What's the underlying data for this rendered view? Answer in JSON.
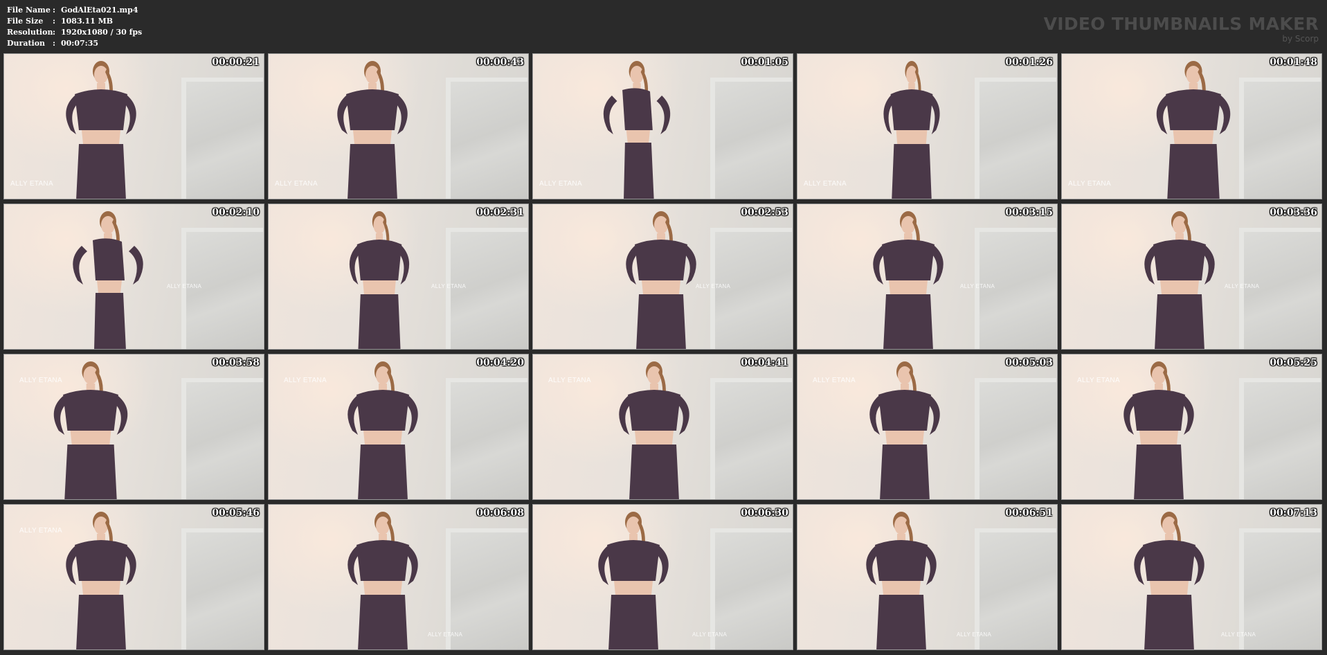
{
  "header": {
    "file_name_label": "File Name",
    "file_name_value": "GodAlEta021.mp4",
    "file_size_label": "File Size",
    "file_size_value": "1083.11 MB",
    "resolution_label": "Resolution",
    "resolution_value": "1920x1080 / 30 fps",
    "duration_label": "Duration",
    "duration_value": "00:07:35",
    "separator": ":",
    "brand_title": "VIDEO THUMBNAILS MAKER",
    "brand_sub": "by Scorp"
  },
  "thumbnails": [
    {
      "time": "00:00:21",
      "watermark": "ALLY ETANA",
      "wm_pos": "bl"
    },
    {
      "time": "00:00:43",
      "watermark": "ALLY ETANA",
      "wm_pos": "bl"
    },
    {
      "time": "00:01:05",
      "watermark": "ALLY ETANA",
      "wm_pos": "bl"
    },
    {
      "time": "00:01:26",
      "watermark": "ALLY ETANA",
      "wm_pos": "bl"
    },
    {
      "time": "00:01:48",
      "watermark": "ALLY ETANA",
      "wm_pos": "bl"
    },
    {
      "time": "00:02:10",
      "watermark": "ALLY ETANA",
      "wm_pos": "mid"
    },
    {
      "time": "00:02:31",
      "watermark": "ALLY ETANA",
      "wm_pos": "mid"
    },
    {
      "time": "00:02:53",
      "watermark": "ALLY ETANA",
      "wm_pos": "mid"
    },
    {
      "time": "00:03:15",
      "watermark": "ALLY ETANA",
      "wm_pos": "mid"
    },
    {
      "time": "00:03:36",
      "watermark": "ALLY ETANA",
      "wm_pos": "mid"
    },
    {
      "time": "00:03:58",
      "watermark": "ALLY ETANA",
      "wm_pos": "tl"
    },
    {
      "time": "00:04:20",
      "watermark": "ALLY ETANA",
      "wm_pos": "tl"
    },
    {
      "time": "00:04:41",
      "watermark": "ALLY ETANA",
      "wm_pos": "tl"
    },
    {
      "time": "00:05:03",
      "watermark": "ALLY ETANA",
      "wm_pos": "tl"
    },
    {
      "time": "00:05:25",
      "watermark": "ALLY ETANA",
      "wm_pos": "tl"
    },
    {
      "time": "00:05:46",
      "watermark": "ALLY ETANA",
      "wm_pos": "tl"
    },
    {
      "time": "00:06:08",
      "watermark": "ALLY ETANA",
      "wm_pos": "br"
    },
    {
      "time": "00:06:30",
      "watermark": "ALLY ETANA",
      "wm_pos": "br"
    },
    {
      "time": "00:06:51",
      "watermark": "ALLY ETANA",
      "wm_pos": "br"
    },
    {
      "time": "00:07:13",
      "watermark": "ALLY ETANA",
      "wm_pos": "br"
    }
  ],
  "colors": {
    "background": "#2a2a2a",
    "outfit": "#4a3848",
    "skin": "#e9c4ae",
    "hair": "#9b6a45"
  }
}
